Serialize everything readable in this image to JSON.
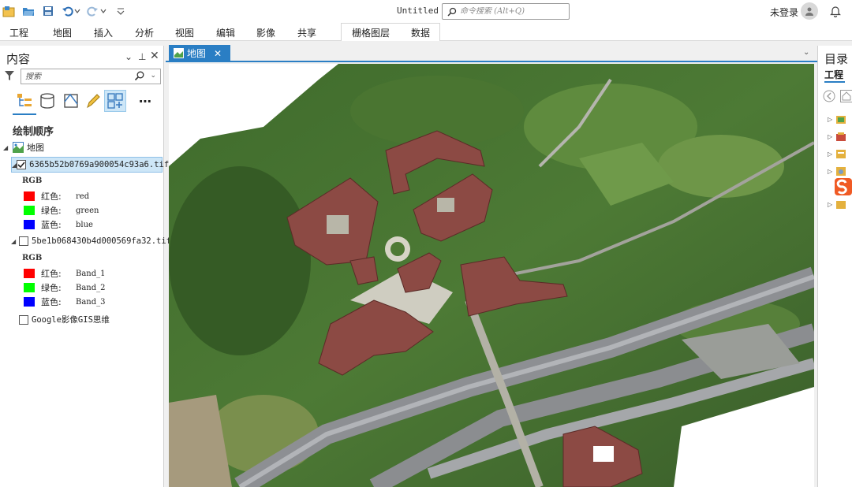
{
  "app": {
    "doc_title": "Untitled",
    "command_search_placeholder": "命令搜索 (Alt+Q)",
    "user_label": "未登录"
  },
  "icons": {
    "new_project": "new-project-icon",
    "open_project": "open-folder-icon",
    "save_project": "save-icon",
    "undo": "undo-icon",
    "redo": "redo-icon",
    "customize": "customize-qat-icon",
    "notifications": "bell-icon"
  },
  "ribbon": {
    "tabs": [
      "工程",
      "地图",
      "插入",
      "分析",
      "视图",
      "编辑",
      "影像",
      "共享"
    ],
    "context_tabs": [
      "栅格图层",
      "数据"
    ]
  },
  "contents": {
    "title": "内容",
    "search_placeholder": "搜索",
    "section_title": "绘制顺序",
    "map_label": "地图",
    "layers": [
      {
        "name": "6365b52b0769a900054c93a6.tif",
        "checked": true,
        "selected": true,
        "renderer": "RGB",
        "bands": [
          {
            "label": "红色:",
            "value": "red",
            "color": "#ff0000"
          },
          {
            "label": "绿色:",
            "value": "green",
            "color": "#00ff00"
          },
          {
            "label": "蓝色:",
            "value": "blue",
            "color": "#0000ff"
          }
        ]
      },
      {
        "name": "5be1b068430b4d000569fa32.tif",
        "checked": false,
        "selected": false,
        "renderer": "RGB",
        "bands": [
          {
            "label": "红色:",
            "value": "Band_1",
            "color": "#ff0000"
          },
          {
            "label": "绿色:",
            "value": "Band_2",
            "color": "#00ff00"
          },
          {
            "label": "蓝色:",
            "value": "Band_3",
            "color": "#0000ff"
          }
        ]
      }
    ],
    "basemap": {
      "name": "Google影像GIS思维",
      "checked": false
    }
  },
  "map_view": {
    "tab_label": "地图"
  },
  "catalog": {
    "title": "目录",
    "tab": "工程"
  },
  "colors": {
    "accent": "#2a7ec4",
    "selected_bg": "#cde6f7"
  }
}
